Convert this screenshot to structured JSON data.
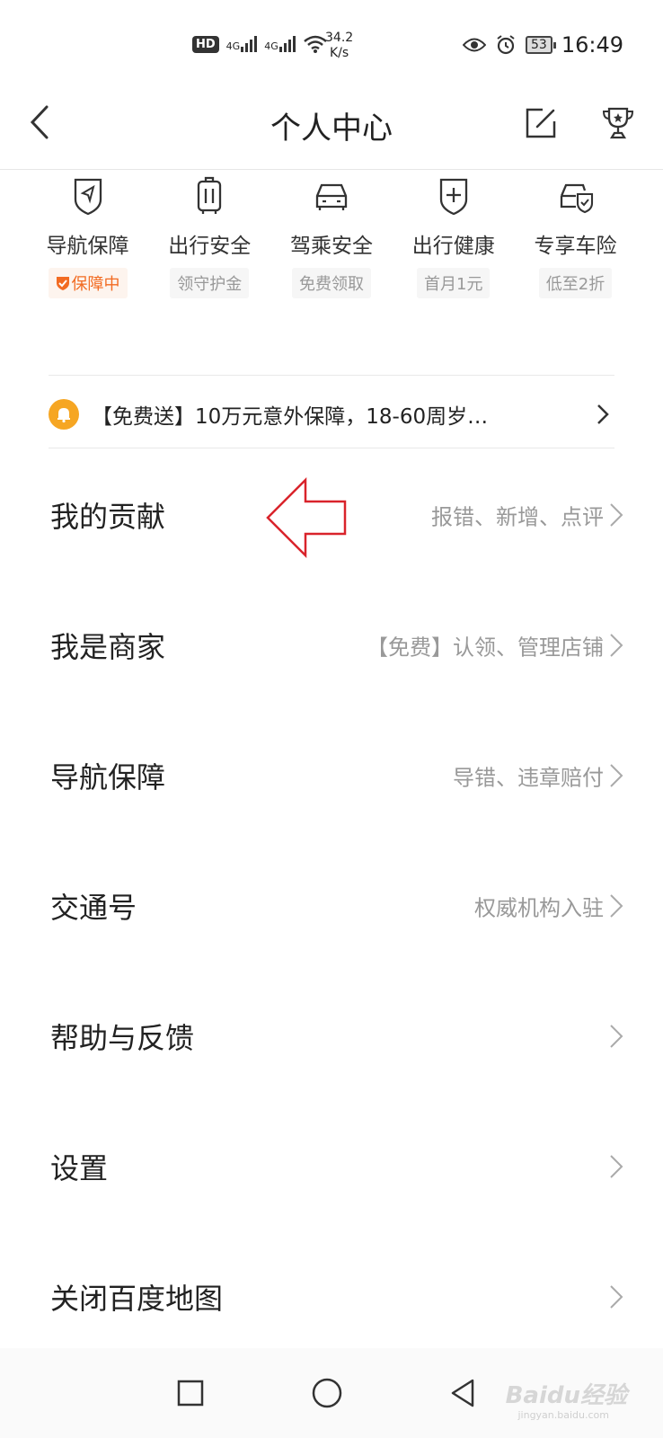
{
  "status_bar": {
    "hd": "HD",
    "sim1": "4G",
    "sim2": "4G",
    "speed_value": "34.2",
    "speed_unit": "K/s",
    "battery": "53",
    "time": "16:49"
  },
  "header": {
    "title": "个人中心",
    "back_icon": "chevron-left-icon",
    "edit_icon": "edit-icon",
    "trophy_icon": "trophy-icon"
  },
  "services": [
    {
      "name": "导航保障",
      "tag": "保障中",
      "icon": "navigation-shield-icon",
      "active": true
    },
    {
      "name": "出行安全",
      "tag": "领守护金",
      "icon": "luggage-icon",
      "active": false
    },
    {
      "name": "驾乘安全",
      "tag": "免费领取",
      "icon": "car-icon",
      "active": false
    },
    {
      "name": "出行健康",
      "tag": "首月1元",
      "icon": "health-shield-icon",
      "active": false
    },
    {
      "name": "专享车险",
      "tag": "低至2折",
      "icon": "car-insurance-icon",
      "active": false
    }
  ],
  "notice": {
    "text": "【免费送】10万元意外保障，18-60周岁…",
    "icon": "bell-icon"
  },
  "menu": [
    {
      "label": "我的贡献",
      "sub": "报错、新增、点评"
    },
    {
      "label": "我是商家",
      "sub": "【免费】认领、管理店铺"
    },
    {
      "label": "导航保障",
      "sub": "导错、违章赔付"
    },
    {
      "label": "交通号",
      "sub": "权威机构入驻"
    },
    {
      "label": "帮助与反馈",
      "sub": ""
    },
    {
      "label": "设置",
      "sub": ""
    },
    {
      "label": "关闭百度地图",
      "sub": ""
    }
  ],
  "watermark": {
    "main": "Baidu经验",
    "sub": "jingyan.baidu.com"
  },
  "colors": {
    "accent_orange": "#f26b22",
    "notice_bell": "#f6a623",
    "annotation_red": "#d9232b"
  }
}
